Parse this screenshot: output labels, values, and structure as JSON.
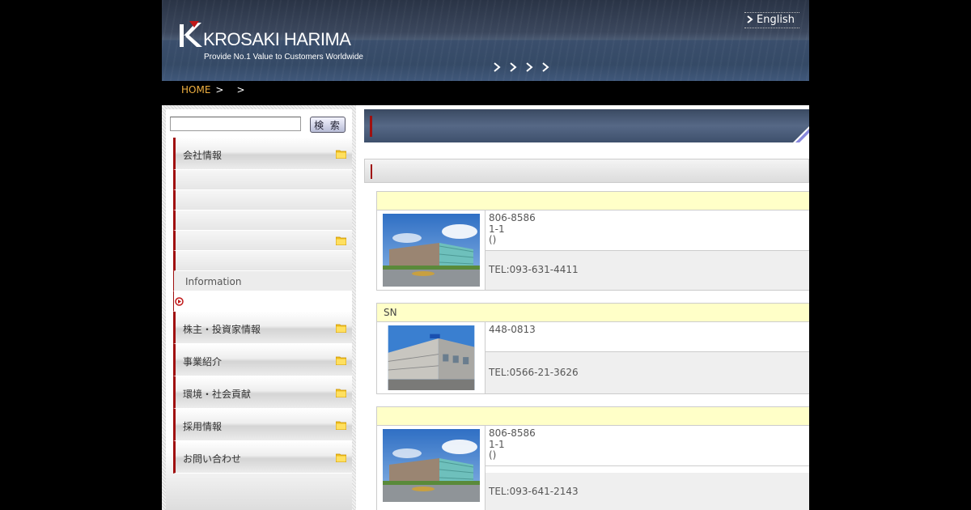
{
  "header": {
    "logo_text": "KROSAKI HARIMA",
    "tagline": "Provide No.1 Value to Customers Worldwide",
    "language_link": "English"
  },
  "breadcrumb": {
    "home": "HOME",
    "separator": ">"
  },
  "search": {
    "placeholder": "",
    "button_label": "検 索"
  },
  "sidebar": {
    "menu": [
      {
        "label": "会社情報"
      },
      {
        "label": "株主・投資家情報"
      },
      {
        "label": "事業紹介"
      },
      {
        "label": "環境・社会貢献"
      },
      {
        "label": "採用情報"
      },
      {
        "label": "お問い合わせ"
      }
    ],
    "submenu": [
      {
        "label": ""
      },
      {
        "label": ""
      },
      {
        "label": ""
      },
      {
        "label": ""
      },
      {
        "label": ""
      },
      {
        "label": "Information"
      },
      {
        "label": ""
      }
    ]
  },
  "offices": [
    {
      "name": "",
      "postal": "806-8586",
      "address_line": "1-1",
      "building": "()",
      "tel": "TEL:093-631-4411"
    },
    {
      "name": "SN",
      "postal": "448-0813",
      "address_line": "",
      "building": "",
      "tel": "TEL:0566-21-3626"
    },
    {
      "name": "",
      "postal": "806-8586",
      "address_line": "1-1",
      "building": "()",
      "tel": "TEL:093-641-2143"
    }
  ],
  "colors": {
    "accent_red": "#a01010",
    "breadcrumb_home": "#f0b040",
    "office_header_bg": "#ffffc8"
  }
}
